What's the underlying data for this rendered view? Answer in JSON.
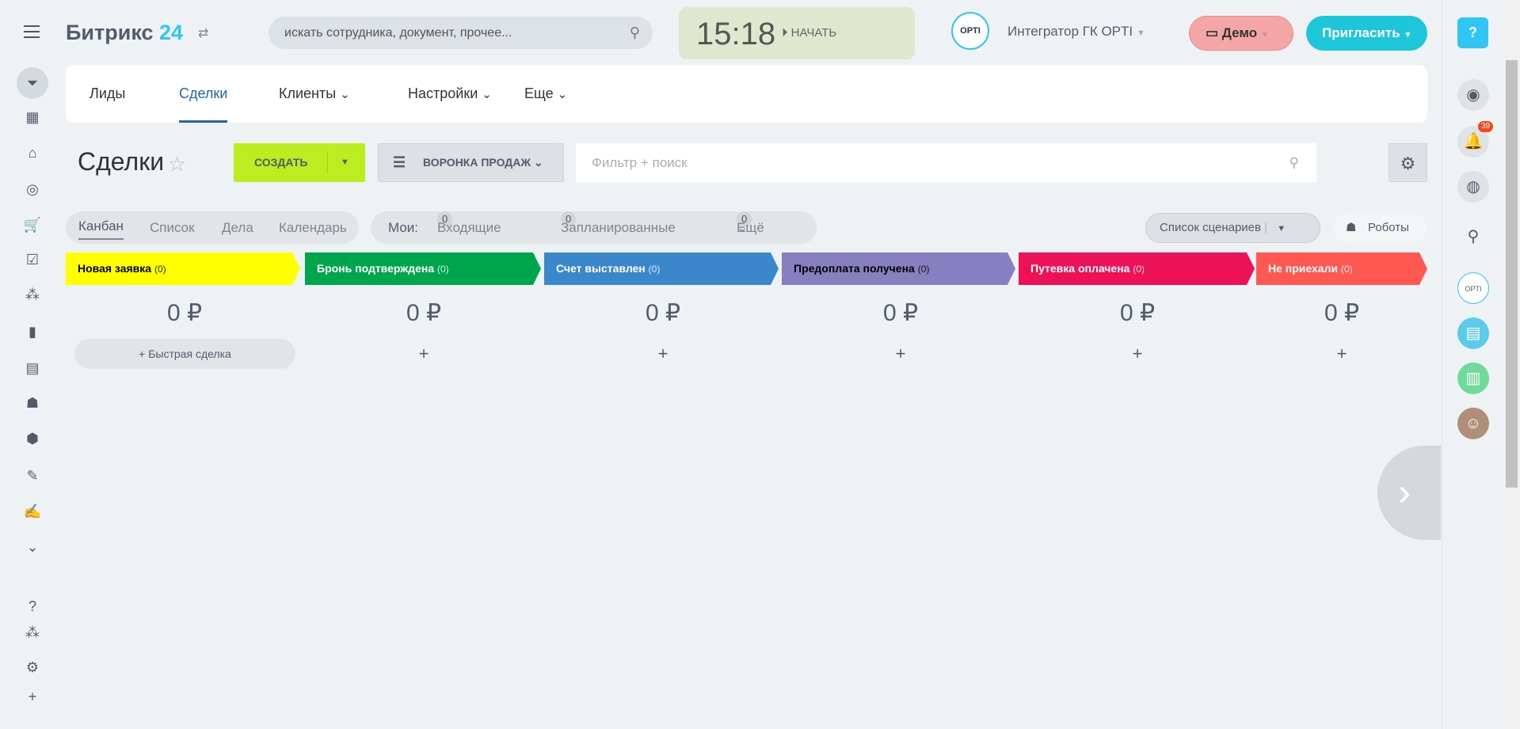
{
  "header": {
    "logo_text": "Битрикс",
    "logo_num": "24",
    "search_placeholder": "искать сотрудника, документ, прочее...",
    "clock": "15:18",
    "start_label": "НАЧАТЬ",
    "avatar_text": "OPTI",
    "company": "Интегратор ГК OPTI",
    "demo_label": "Демо",
    "invite_label": "Пригласить",
    "help_label": "?"
  },
  "nav": {
    "tabs": [
      {
        "label": "Лиды"
      },
      {
        "label": "Сделки"
      },
      {
        "label": "Клиенты"
      },
      {
        "label": "Настройки"
      },
      {
        "label": "Еще"
      }
    ]
  },
  "toolbar": {
    "title": "Сделки",
    "create_label": "СОЗДАТЬ",
    "funnel_label": "ВОРОНКА ПРОДАЖ",
    "filter_placeholder": "Фильтр + поиск"
  },
  "views": {
    "items": [
      "Канбан",
      "Список",
      "Дела",
      "Календарь"
    ],
    "my_label": "Мои:",
    "counters": [
      {
        "count": "0",
        "label": "Входящие"
      },
      {
        "count": "0",
        "label": "Запланированные"
      },
      {
        "count": "0",
        "label": "Ещё"
      }
    ],
    "scenarios_label": "Список сценариев",
    "robots_label": "Роботы"
  },
  "columns": [
    {
      "name": "Новая заявка",
      "count": "(0)",
      "sum": "0 ₽",
      "color": "#ffff00",
      "text_color": "#000000"
    },
    {
      "name": "Бронь подтверждена",
      "count": "(0)",
      "sum": "0 ₽",
      "color": "#00a64c",
      "text_color": "#ffffff"
    },
    {
      "name": "Счет выставлен",
      "count": "(0)",
      "sum": "0 ₽",
      "color": "#3a87cc",
      "text_color": "#ffffff"
    },
    {
      "name": "Предоплата получена",
      "count": "(0)",
      "sum": "0 ₽",
      "color": "#877fbf",
      "text_color": "#000000"
    },
    {
      "name": "Путевка оплачена",
      "count": "(0)",
      "sum": "0 ₽",
      "color": "#ed1157",
      "text_color": "#ffffff"
    },
    {
      "name": "Не приехали",
      "count": "(0)",
      "sum": "0 ₽",
      "color": "#ff5752",
      "text_color": "#ffffff"
    }
  ],
  "quick_deal_label": "Быстрая сделка",
  "notifications_count": "39"
}
